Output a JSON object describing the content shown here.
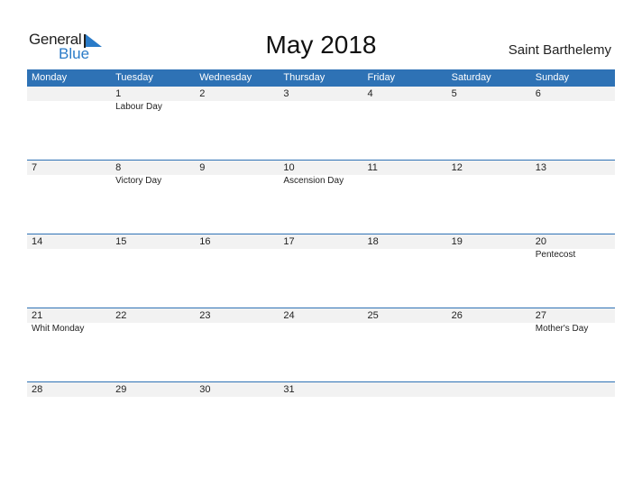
{
  "logo": {
    "general": "General",
    "blue": "Blue"
  },
  "title": "May 2018",
  "region": "Saint Barthelemy",
  "weekdays": [
    "Monday",
    "Tuesday",
    "Wednesday",
    "Thursday",
    "Friday",
    "Saturday",
    "Sunday"
  ],
  "weeks": [
    {
      "days": [
        "",
        "1",
        "2",
        "3",
        "4",
        "5",
        "6"
      ],
      "events": [
        "",
        "Labour Day",
        "",
        "",
        "",
        "",
        ""
      ]
    },
    {
      "days": [
        "7",
        "8",
        "9",
        "10",
        "11",
        "12",
        "13"
      ],
      "events": [
        "",
        "Victory Day",
        "",
        "Ascension Day",
        "",
        "",
        ""
      ]
    },
    {
      "days": [
        "14",
        "15",
        "16",
        "17",
        "18",
        "19",
        "20"
      ],
      "events": [
        "",
        "",
        "",
        "",
        "",
        "",
        "Pentecost"
      ]
    },
    {
      "days": [
        "21",
        "22",
        "23",
        "24",
        "25",
        "26",
        "27"
      ],
      "events": [
        "Whit Monday",
        "",
        "",
        "",
        "",
        "",
        "Mother's Day"
      ]
    },
    {
      "days": [
        "28",
        "29",
        "30",
        "31",
        "",
        "",
        ""
      ],
      "events": [
        "",
        "",
        "",
        "",
        "",
        "",
        ""
      ]
    }
  ]
}
